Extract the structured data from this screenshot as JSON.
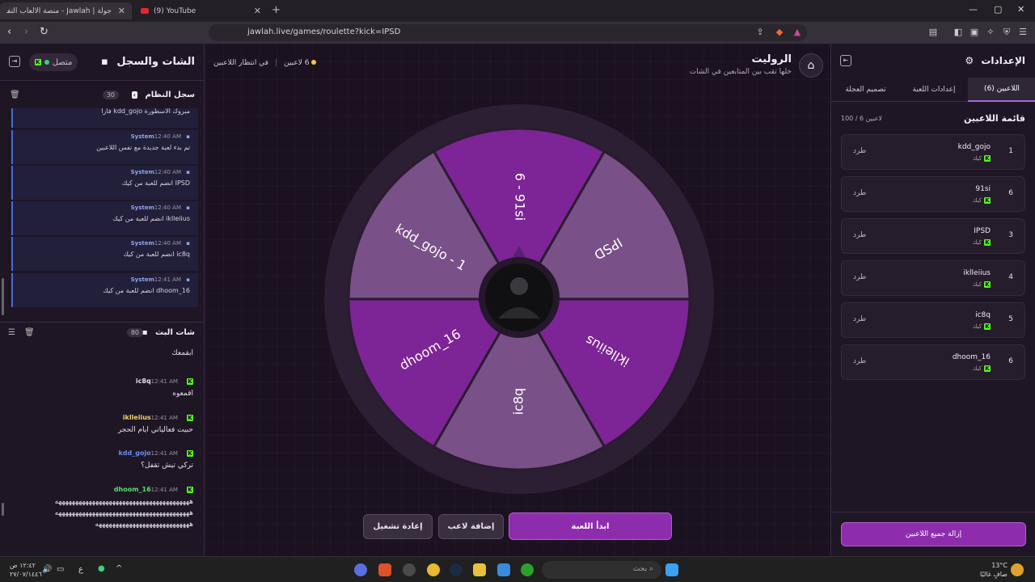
{
  "browser": {
    "tabs": [
      {
        "label": "جولة | Jawlah - منصة الألعاب التفا"
      },
      {
        "label": "(9) YouTube"
      }
    ],
    "url": "jawlah.live/games/roulette?kick=IPSD"
  },
  "left_panel": {
    "title": "الشات والسجل",
    "connection": "متصل",
    "system_log": {
      "title": "سجل النظام",
      "count": "30",
      "entries": [
        {
          "sender": "",
          "time": "",
          "text": "مبروك الاسطورة kdd_gojo فازا"
        },
        {
          "sender": "System",
          "time": "12:40 AM",
          "text": "تم بدء لعبة جديدة مع نفس اللاعبين"
        },
        {
          "sender": "System",
          "time": "12:40 AM",
          "text": "IPSD انضم للعبة من كيك"
        },
        {
          "sender": "System",
          "time": "12:40 AM",
          "text": "iklleiius انضم للعبة من كيك"
        },
        {
          "sender": "System",
          "time": "12:40 AM",
          "text": "ic8q انضم للعبة من كيك"
        },
        {
          "sender": "System",
          "time": "12:41 AM",
          "text": "dhoom_16 انضم للعبة من كيك"
        }
      ]
    },
    "stream_chat": {
      "title": "شات البث",
      "count": "80",
      "messages": [
        {
          "user": "",
          "time": "",
          "text": "ابقمعك",
          "color": "#e4dfe8"
        },
        {
          "user": "ic8q",
          "time": "12:41 AM",
          "text": "اقمعوه",
          "color": "#e4dfe8"
        },
        {
          "user": "iklleiius",
          "time": "12:41 AM",
          "text": "حبيت فعالياتي ايام الحجر",
          "color": "#f0d26a"
        },
        {
          "user": "kdd_gojo",
          "time": "12:41 AM",
          "text": "تركي تيش تقفل؟",
          "color": "#6b8cf0"
        },
        {
          "user": "dhoom_16",
          "time": "12:41 AM",
          "text": "ههههههههههههههههههههههههههههههههههههههههه",
          "color": "#57e06a"
        }
      ],
      "extra_lines": [
        "ههههههههههههههههههههههههههههههههههههههههه",
        "ههههههههههههههههههههههههههههه"
      ]
    }
  },
  "center": {
    "title": "الروليت",
    "subtitle": "خلها تقب بين المتابعين في الشات",
    "players_count": "6 لاعبين",
    "status": "في انتظار اللاعبين",
    "wheel": {
      "segments": [
        "6 - 91si",
        "IPSD",
        "iklleiius",
        "ic8q",
        "dhoom_16",
        "kdd_gojo - 1"
      ],
      "colors": [
        "#7d2496",
        "#7a5088",
        "#7d2496",
        "#7a5088",
        "#7d2496",
        "#7a5088"
      ]
    },
    "buttons": {
      "start": "ابدأ اللعبة",
      "add_player": "إضافة لاعب",
      "restart": "إعادة تشغيل"
    }
  },
  "right_panel": {
    "title": "الإعدادات",
    "tabs": [
      "اللاعبين (6)",
      "إعدادات اللعبة",
      "تصميم العجلة"
    ],
    "players_title": "قائمة اللاعبين",
    "players_limit": "100 / 6 لاعبين",
    "players": [
      {
        "num": "1",
        "name": "kdd_gojo",
        "platform": "كيك",
        "kick": "طرد"
      },
      {
        "num": "6",
        "name": "91si",
        "platform": "كيك",
        "kick": "طرد"
      },
      {
        "num": "3",
        "name": "IPSD",
        "platform": "كيك",
        "kick": "طرد"
      },
      {
        "num": "4",
        "name": "iklleiius",
        "platform": "كيك",
        "kick": "طرد"
      },
      {
        "num": "5",
        "name": "ic8q",
        "platform": "كيك",
        "kick": "طرد"
      },
      {
        "num": "6",
        "name": "dhoom_16",
        "platform": "كيك",
        "kick": "طرد"
      }
    ],
    "clear_all": "إزالة جميع اللاعبين"
  },
  "taskbar": {
    "search": "بحث",
    "weather_temp": "13°C",
    "weather_desc": "صافٍ غالبًا",
    "time": "١٢:٤٢ ص",
    "date": "٢٧/٠٧/١٤٤٦"
  }
}
